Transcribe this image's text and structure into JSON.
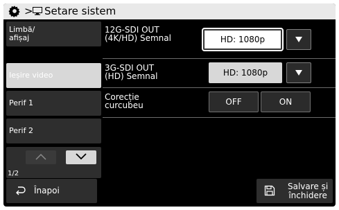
{
  "header": {
    "separator": ">",
    "title": "Setare sistem",
    "icons": [
      "gear-icon",
      "monitor-icon"
    ]
  },
  "nav": {
    "items": [
      {
        "label": "Limbă/\nafișaj",
        "selected": false
      },
      {
        "label": "Ieșire video",
        "selected": true
      },
      {
        "label": "Perif 1",
        "selected": false
      },
      {
        "label": "Perif 2",
        "selected": false
      }
    ],
    "pager": {
      "page": "1/2"
    }
  },
  "settings": [
    {
      "label": "12G-SDI OUT\n(4K/HD) Semnal",
      "value": "HD: 1080p"
    },
    {
      "label": "3G-SDI OUT\n(HD) Semnal",
      "value": "HD: 1080p"
    },
    {
      "label": "Corecție\ncurcubeu",
      "options": [
        "OFF",
        "ON"
      ]
    }
  ],
  "footer": {
    "back_label": "Înapoi",
    "save_label": "Salvare și\nînchidere"
  },
  "colors": {
    "background": "#000000",
    "panel": "#2e2e2e",
    "selected": "#d8d8d8",
    "header": "#e9e9e9"
  }
}
